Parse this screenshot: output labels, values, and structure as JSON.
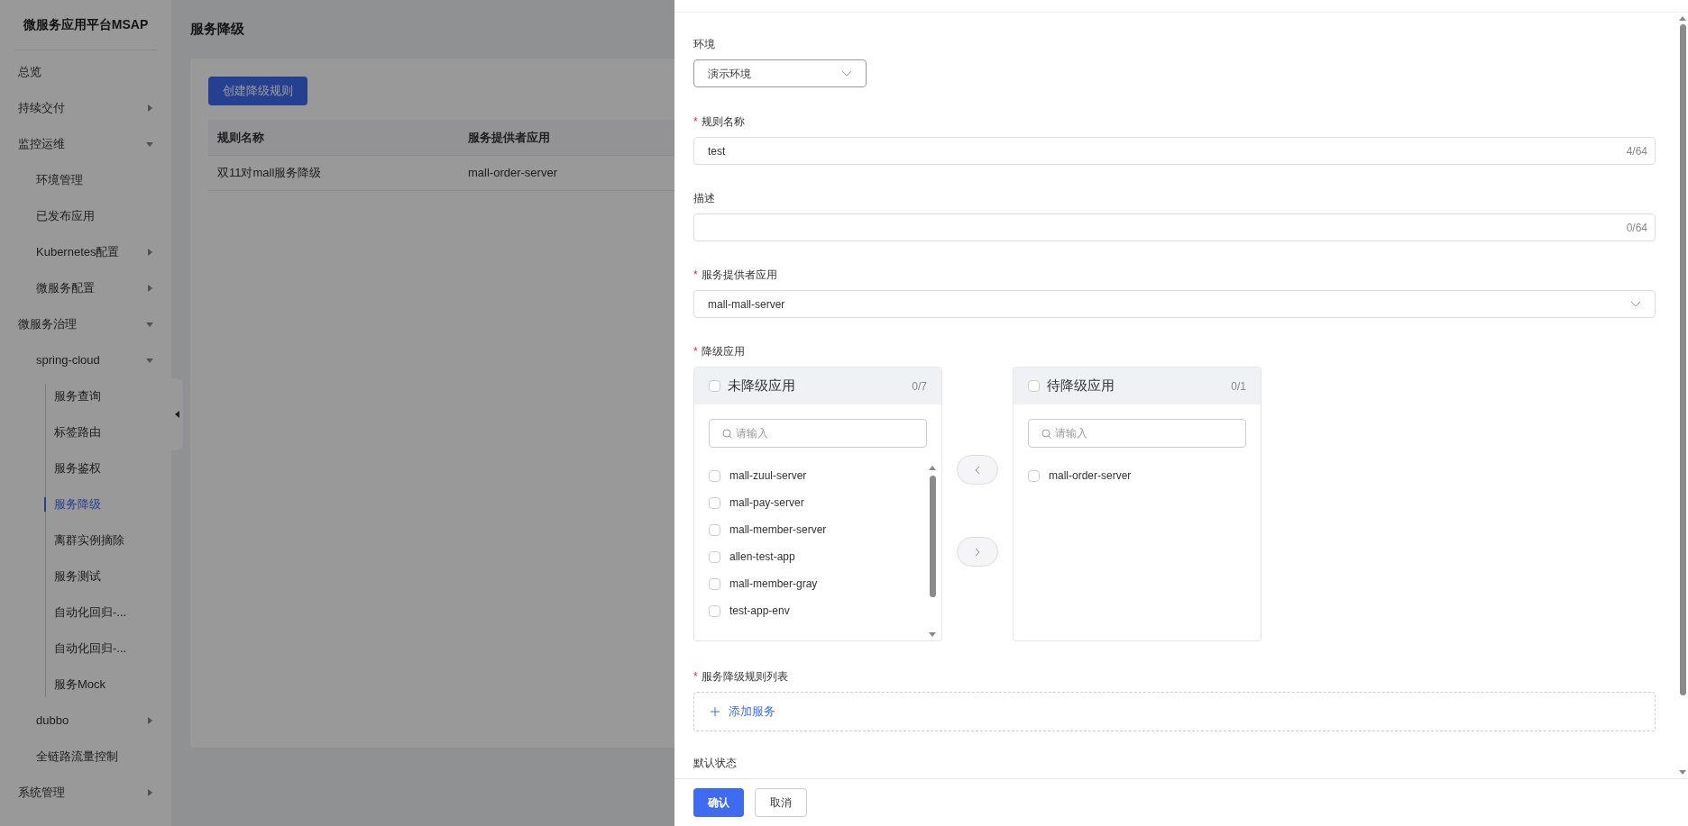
{
  "sidebar": {
    "title": "微服务应用平台MSAP",
    "items": [
      {
        "label": "总览",
        "selected": false
      },
      {
        "label": "持续交付",
        "expanded": false,
        "selected": false
      },
      {
        "label": "监控运维",
        "expanded": true,
        "selected": false,
        "children": [
          {
            "label": "环境管理",
            "selected": false
          },
          {
            "label": "已发布应用",
            "selected": false
          },
          {
            "label": "Kubernetes配置",
            "expanded": false,
            "selected": false
          },
          {
            "label": "微服务配置",
            "expanded": false,
            "selected": false
          }
        ]
      },
      {
        "label": "微服务治理",
        "expanded": true,
        "selected": false,
        "children": [
          {
            "label": "spring-cloud",
            "expanded": true,
            "selected": false,
            "children": [
              {
                "label": "服务查询",
                "selected": false
              },
              {
                "label": "标签路由",
                "selected": false
              },
              {
                "label": "服务鉴权",
                "selected": false
              },
              {
                "label": "服务降级",
                "selected": true
              },
              {
                "label": "离群实例摘除",
                "selected": false
              },
              {
                "label": "服务测试",
                "selected": false
              },
              {
                "label": "自动化回归-...",
                "selected": false
              },
              {
                "label": "自动化回归-...",
                "selected": false
              },
              {
                "label": "服务Mock",
                "selected": false
              }
            ]
          },
          {
            "label": "dubbo",
            "expanded": false,
            "selected": false
          },
          {
            "label": "全链路流量控制",
            "selected": false
          }
        ]
      },
      {
        "label": "系统管理",
        "expanded": false,
        "selected": false
      }
    ]
  },
  "page": {
    "title": "服务降级",
    "create_button": "创建降级规则",
    "table": {
      "columns": [
        "规则名称",
        "服务提供者应用"
      ],
      "rows": [
        [
          "双11对mall服务降级",
          "mall-order-server"
        ]
      ]
    }
  },
  "drawer": {
    "environment": {
      "label": "环境",
      "value": "演示环境"
    },
    "rule_name": {
      "label": "规则名称",
      "required_mark": "*",
      "value": "test",
      "counter": "4/64"
    },
    "description": {
      "label": "描述",
      "counter": "0/64"
    },
    "provider": {
      "label": "服务提供者应用",
      "required_mark": "*",
      "value": "mall-mall-server"
    },
    "transfer": {
      "label": "降级应用",
      "required_mark": "*",
      "left": {
        "title": "未降级应用",
        "count": "0/7",
        "checked": false,
        "placeholder": "请输入",
        "items": [
          {
            "label": "mall-zuul-server",
            "checked": false
          },
          {
            "label": "mall-pay-server",
            "checked": false
          },
          {
            "label": "mall-member-server",
            "checked": false
          },
          {
            "label": "allen-test-app",
            "checked": false
          },
          {
            "label": "mall-member-gray",
            "checked": false
          },
          {
            "label": "test-app-env",
            "checked": false
          }
        ]
      },
      "right": {
        "title": "待降级应用",
        "count": "0/1",
        "checked": false,
        "placeholder": "请输入",
        "items": [
          {
            "label": "mall-order-server",
            "checked": false
          }
        ]
      }
    },
    "rule_list": {
      "label": "服务降级规则列表",
      "required_mark": "*",
      "add_button": "添加服务"
    },
    "default_state": {
      "label": "默认状态"
    },
    "buttons": [
      {
        "label": "确认",
        "primary": true
      },
      {
        "label": "取消",
        "primary": false
      }
    ]
  }
}
